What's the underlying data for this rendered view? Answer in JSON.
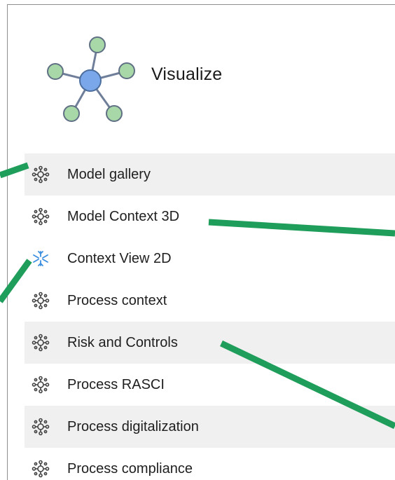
{
  "header": {
    "title": "Visualize",
    "icon": "network-graph-icon"
  },
  "menu": {
    "items": [
      {
        "label": "Model gallery",
        "icon": "model-node-icon",
        "shaded": true
      },
      {
        "label": "Model Context 3D",
        "icon": "model-node-icon",
        "shaded": false
      },
      {
        "label": "Context View 2D",
        "icon": "context-view-icon",
        "shaded": false
      },
      {
        "label": "Process context",
        "icon": "model-node-icon",
        "shaded": false
      },
      {
        "label": "Risk and Controls",
        "icon": "model-node-icon",
        "shaded": true
      },
      {
        "label": "Process RASCI",
        "icon": "model-node-icon",
        "shaded": false
      },
      {
        "label": "Process digitalization",
        "icon": "model-node-icon",
        "shaded": true
      },
      {
        "label": "Process compliance",
        "icon": "model-node-icon",
        "shaded": false
      }
    ]
  },
  "colors": {
    "annotation_arrow": "#1f9d5a",
    "node_green": "#a8d8a8",
    "node_blue": "#7aa6ea",
    "context_icon_blue": "#3b8fe0"
  }
}
